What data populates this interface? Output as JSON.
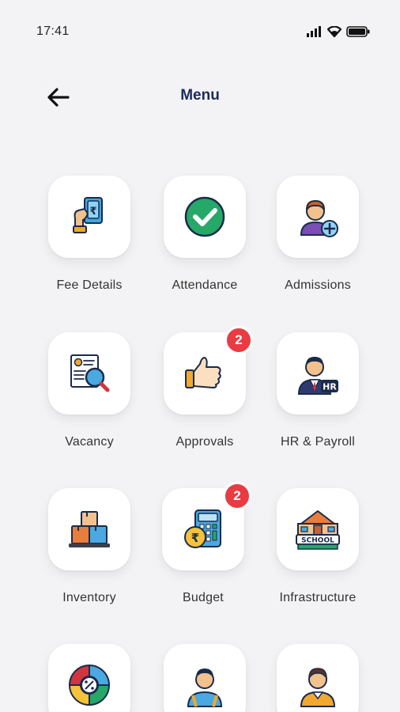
{
  "status_bar": {
    "time": "17:41"
  },
  "header": {
    "title": "Menu"
  },
  "colors": {
    "title": "#1c2a5e",
    "badge": "#ea3b43",
    "background": "#f3f3f5"
  },
  "menu": [
    {
      "label": "Fee Details",
      "icon": "hand-rupee-card-icon"
    },
    {
      "label": "Attendance",
      "icon": "check-circle-icon"
    },
    {
      "label": "Admissions",
      "icon": "person-add-icon"
    },
    {
      "label": "Vacancy",
      "icon": "document-search-icon"
    },
    {
      "label": "Approvals",
      "icon": "thumbs-up-icon",
      "badge": "2"
    },
    {
      "label": "HR & Payroll",
      "icon": "hr-person-icon"
    },
    {
      "label": "Inventory",
      "icon": "boxes-icon"
    },
    {
      "label": "Budget",
      "icon": "calculator-rupee-icon",
      "badge": "2"
    },
    {
      "label": "Infrastructure",
      "icon": "school-building-icon"
    },
    {
      "label": "",
      "icon": "percent-wheel-icon"
    },
    {
      "label": "",
      "icon": "student-backpack-icon"
    },
    {
      "label": "",
      "icon": "person-icon"
    }
  ]
}
